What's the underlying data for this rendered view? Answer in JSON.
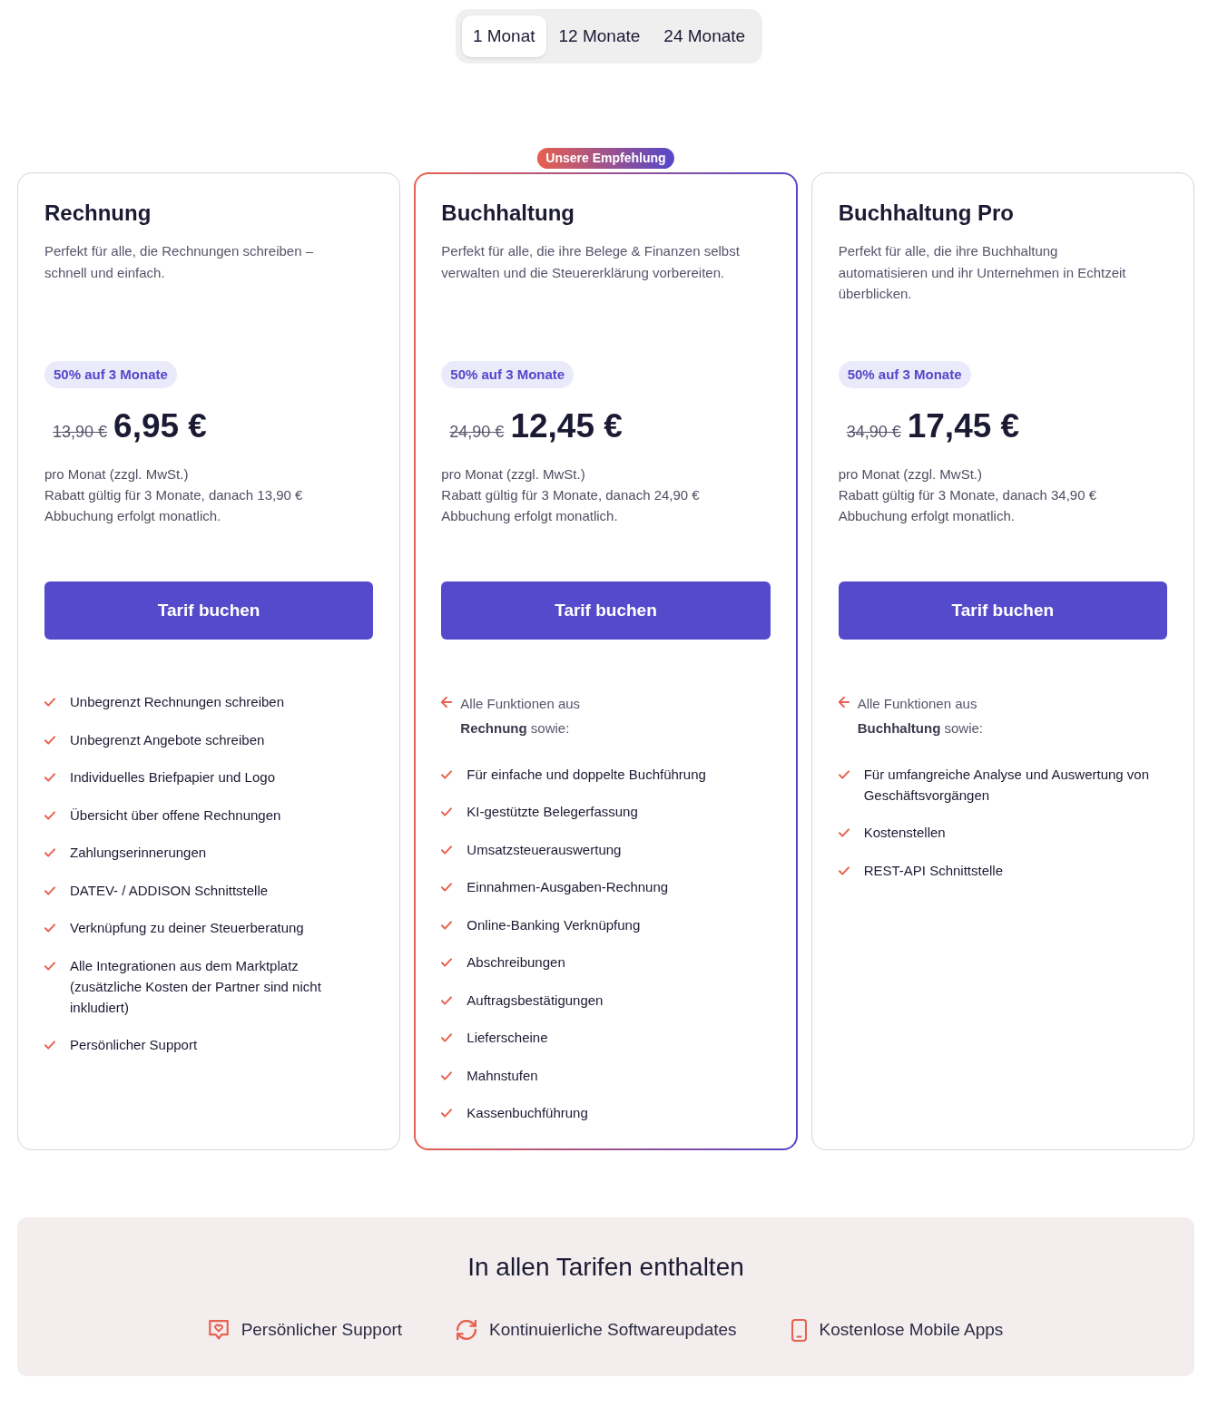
{
  "billing_tabs": [
    {
      "label": "1 Monat",
      "selected": true
    },
    {
      "label": "12 Monate",
      "selected": false
    },
    {
      "label": "24 Monate",
      "selected": false
    }
  ],
  "plans": [
    {
      "name": "Rechnung",
      "highlighted": false,
      "description": "Perfekt für alle, die Rechnungen schreiben – schnell und einfach.",
      "discount": "50% auf 3 Monate",
      "old_price": "13,90 €",
      "price": "6,95 €",
      "notes": [
        "pro Monat (zzgl. MwSt.)",
        "Rabatt gültig für 3 Monate, danach 13,90 €",
        "Abbuchung erfolgt monatlich."
      ],
      "button": "Tarif buchen",
      "features": [
        "Unbegrenzt Rechnungen schreiben",
        "Unbegrenzt Angebote schreiben",
        "Individuelles Briefpapier und Logo",
        "Übersicht über offene Rechnungen",
        "Zahlungserinnerungen",
        "DATEV- / ADDISON Schnittstelle",
        "Verknüpfung zu deiner Steuerberatung",
        "Alle Integrationen aus dem Marktplatz (zusätzliche Kosten der Partner sind nicht inkludiert)",
        "Persönlicher Support"
      ]
    },
    {
      "name": "Buchhaltung",
      "highlighted": true,
      "badge": "Unsere Empfehlung",
      "description": "Perfekt für alle, die ihre Belege & Finanzen selbst verwalten und die Steuererklärung vorbereiten.",
      "discount": "50% auf 3 Monate",
      "old_price": "24,90 €",
      "price": "12,45 €",
      "notes": [
        "pro Monat (zzgl. MwSt.)",
        "Rabatt gültig für 3 Monate, danach 24,90 €",
        "Abbuchung erfolgt monatlich."
      ],
      "button": "Tarif buchen",
      "intro": "Alle Funktionen aus **Rechnung** sowie:",
      "features": [
        "Für einfache und doppelte Buchführung",
        "KI-gestützte Belegerfassung",
        "Umsatzsteuerauswertung",
        "Einnahmen-Ausgaben-Rechnung",
        "Online-Banking Verknüpfung",
        "Abschreibungen",
        "Auftragsbestätigungen",
        "Lieferscheine",
        "Mahnstufen",
        "Kassenbuchführung"
      ]
    },
    {
      "name": "Buchhaltung Pro",
      "highlighted": false,
      "description": "Perfekt für alle, die ihre Buchhaltung automatisieren und ihr Unternehmen in Echtzeit überblicken.",
      "discount": "50% auf 3 Monate",
      "old_price": "34,90 €",
      "price": "17,45 €",
      "notes": [
        "pro Monat (zzgl. MwSt.)",
        "Rabatt gültig für 3 Monate, danach 34,90 €",
        "Abbuchung erfolgt monatlich."
      ],
      "button": "Tarif buchen",
      "intro": "Alle Funktionen aus **Buchhaltung** sowie:",
      "features": [
        "Für umfangreiche Analyse und Auswertung von Geschäftsvorgängen",
        "Kostenstellen",
        "REST-API Schnittstelle"
      ]
    }
  ],
  "included": {
    "title": "In allen Tarifen enthalten",
    "items": [
      {
        "kind": "support",
        "label": "Persönlicher Support"
      },
      {
        "kind": "updates",
        "label": "Kontinuierliche Softwareupdates"
      },
      {
        "kind": "mobile",
        "label": "Kostenlose Mobile Apps"
      }
    ]
  }
}
